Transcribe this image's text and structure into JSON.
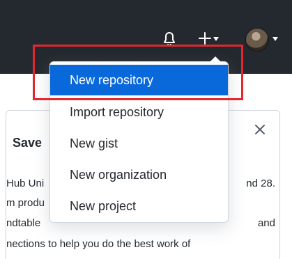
{
  "colors": {
    "header_bg": "#24292f",
    "accent": "#0969da",
    "highlight": "#e3262f",
    "text": "#24292f"
  },
  "header": {
    "icons": [
      "bell-icon",
      "plus-icon",
      "chevron-down-icon",
      "avatar"
    ]
  },
  "card": {
    "title": "Save",
    "close_label": "×",
    "lines": [
      {
        "left": "Hub Uni",
        "right": "nd 28."
      },
      {
        "left": "m produ",
        "right": ""
      },
      {
        "left": "ndtable",
        "right": "and"
      },
      {
        "left": "nections to help you do the best work of",
        "right": ""
      }
    ]
  },
  "dropdown": {
    "items": [
      {
        "label": "New repository",
        "active": true
      },
      {
        "label": "Import repository",
        "active": false
      },
      {
        "label": "New gist",
        "active": false
      },
      {
        "label": "New organization",
        "active": false
      },
      {
        "label": "New project",
        "active": false
      }
    ]
  }
}
